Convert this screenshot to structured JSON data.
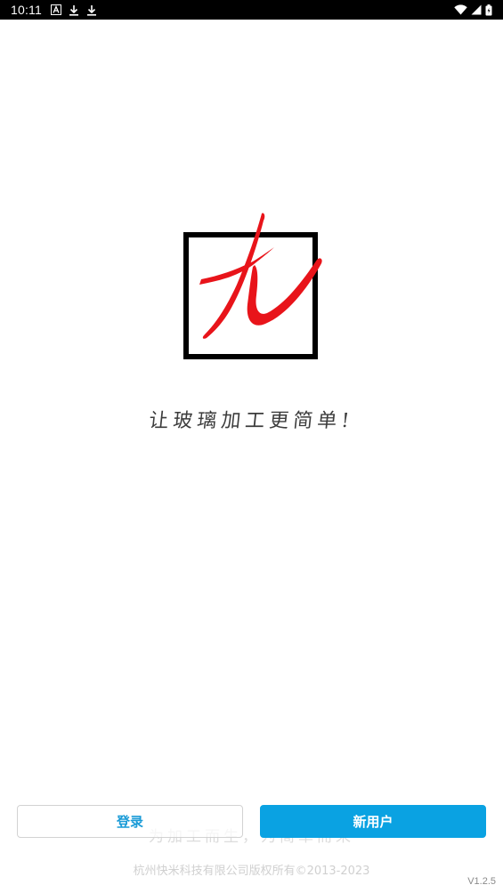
{
  "status_bar": {
    "time": "10:11",
    "icons_left": [
      "font-notification-icon",
      "download-icon",
      "download-icon"
    ],
    "icons_right": [
      "wifi-icon",
      "signal-icon",
      "battery-icon"
    ]
  },
  "brand": {
    "logo": "jiu-calligraphy-logo",
    "logo_frame_color": "#000000",
    "logo_stroke_color": "#e8141a",
    "slogan": "让玻璃加工更简单!"
  },
  "faint_text": "为加工而生，为简单而来",
  "actions": {
    "login_label": "登录",
    "register_label": "新用户",
    "accent_color": "#0aa2e2"
  },
  "footer": {
    "copyright": "杭州快米科技有限公司版权所有©2013-2023",
    "version": "V1.2.5"
  }
}
